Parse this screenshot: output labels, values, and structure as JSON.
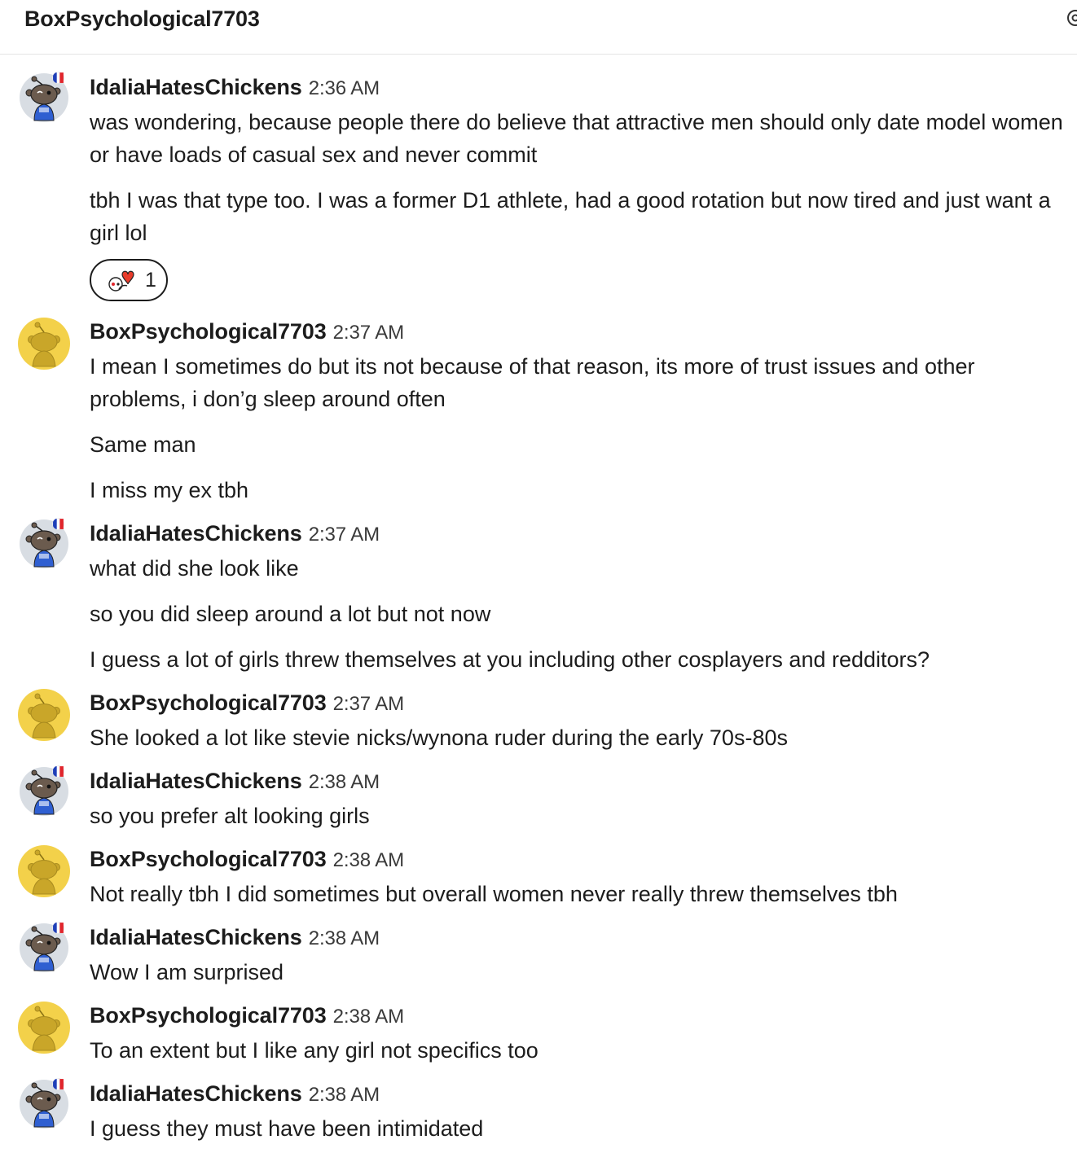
{
  "header": {
    "title": "BoxPsychological7703",
    "settings_icon": "gear-icon"
  },
  "colors": {
    "snoo_gold": "#f3d14a",
    "snoo_gray": "#d8dde3",
    "text": "#1c1c1c"
  },
  "messages": [
    {
      "user": "IdaliaHatesChickens",
      "time": "2:36 AM",
      "avatar": "snoo-gray-avatar",
      "lines": [
        "was wondering, because people there do believe that attractive men should only date model women or have loads of casual sex and never commit",
        "tbh I was that type too. I was a former D1 athlete, had a good rotation but now tired and just want a girl lol"
      ],
      "reaction": {
        "icon": "heart-snoo-icon",
        "count": "1"
      }
    },
    {
      "user": "BoxPsychological7703",
      "time": "2:37 AM",
      "avatar": "snoo-gold-avatar",
      "lines": [
        "I mean I sometimes do but its not because of that reason, its more of trust issues and other problems, i don’g sleep around often",
        "Same man",
        "I miss my ex tbh"
      ]
    },
    {
      "user": "IdaliaHatesChickens",
      "time": "2:37 AM",
      "avatar": "snoo-gray-avatar",
      "lines": [
        "what did she look like",
        "so you did sleep around a lot but not now",
        "I guess a lot of girls threw themselves at you including other cosplayers and redditors?"
      ]
    },
    {
      "user": "BoxPsychological7703",
      "time": "2:37 AM",
      "avatar": "snoo-gold-avatar",
      "lines": [
        "She looked a lot like stevie nicks/wynona ruder during the early 70s-80s"
      ]
    },
    {
      "user": "IdaliaHatesChickens",
      "time": "2:38 AM",
      "avatar": "snoo-gray-avatar",
      "lines": [
        "so you prefer alt looking girls"
      ]
    },
    {
      "user": "BoxPsychological7703",
      "time": "2:38 AM",
      "avatar": "snoo-gold-avatar",
      "lines": [
        "Not really tbh I did sometimes but overall women never really threw themselves tbh"
      ]
    },
    {
      "user": "IdaliaHatesChickens",
      "time": "2:38 AM",
      "avatar": "snoo-gray-avatar",
      "lines": [
        "Wow I am surprised"
      ]
    },
    {
      "user": "BoxPsychological7703",
      "time": "2:38 AM",
      "avatar": "snoo-gold-avatar",
      "lines": [
        "To an extent but I like any girl not specifics too"
      ]
    },
    {
      "user": "IdaliaHatesChickens",
      "time": "2:38 AM",
      "avatar": "snoo-gray-avatar",
      "lines": [
        "I guess they must have been intimidated"
      ]
    }
  ]
}
